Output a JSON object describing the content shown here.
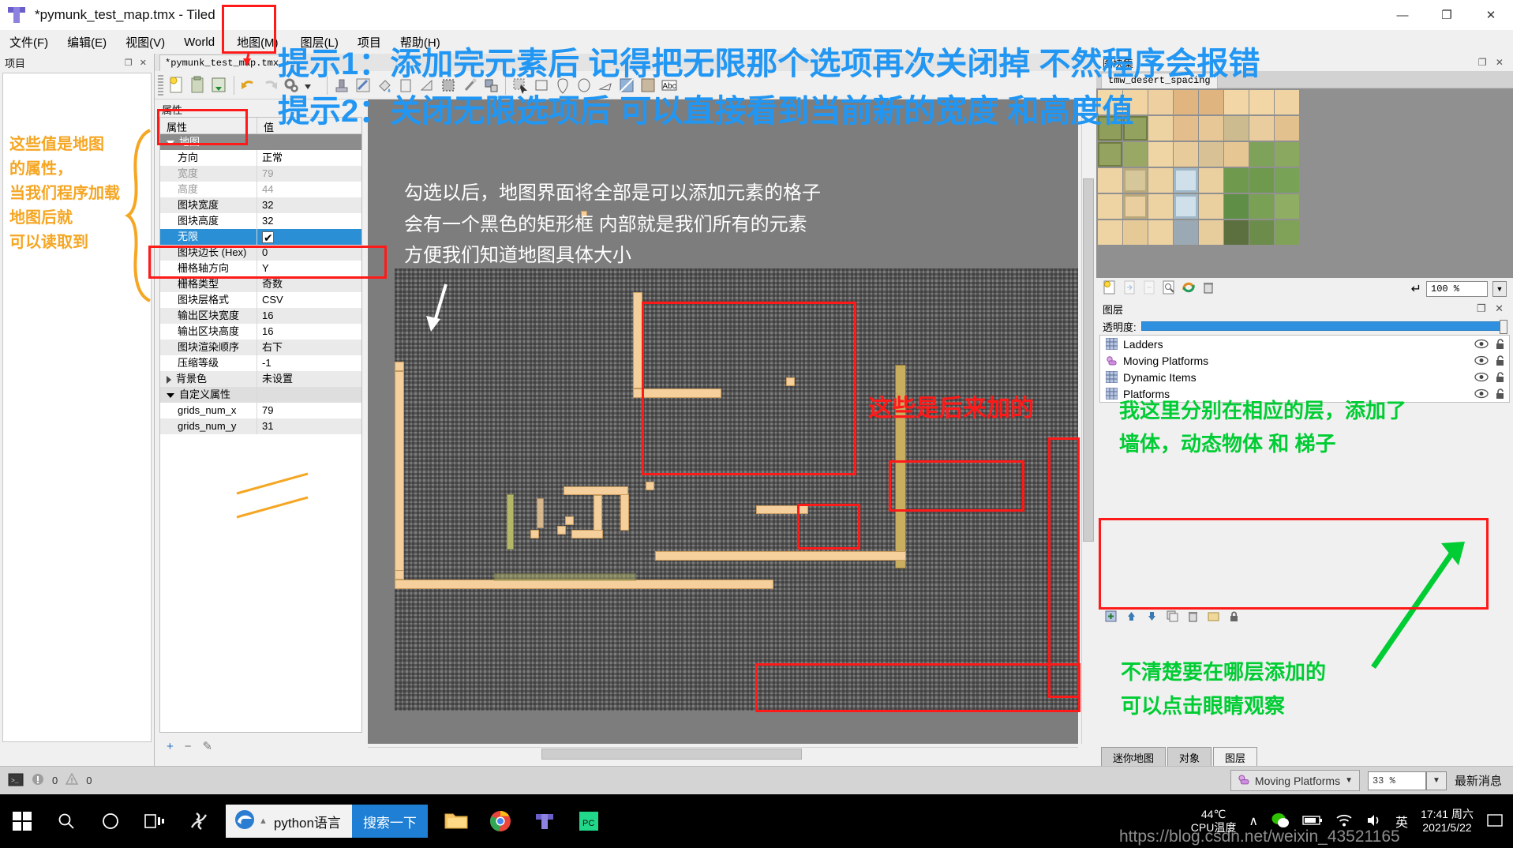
{
  "window": {
    "title": "*pymunk_test_map.tmx - Tiled",
    "logo_icon": "tiled-logo-icon",
    "minimize": "—",
    "maximize": "❐",
    "close": "✕"
  },
  "menubar": {
    "items": [
      {
        "label": "文件(F)"
      },
      {
        "label": "编辑(E)"
      },
      {
        "label": "视图(V)"
      },
      {
        "label": "World"
      },
      {
        "label": "地图(M)"
      },
      {
        "label": "图层(L)"
      },
      {
        "label": "项目"
      },
      {
        "label": "帮助(H)"
      }
    ]
  },
  "project_panel": {
    "title": "项目"
  },
  "document": {
    "tab_label": "*pymunk_test_map.tmx",
    "tab_close": "✕"
  },
  "properties": {
    "dock_title": "属性",
    "header": {
      "name": "属性",
      "value": "值"
    },
    "group_label": "地图",
    "rows": [
      {
        "name": "方向",
        "value": "正常",
        "dim": false
      },
      {
        "name": "宽度",
        "value": "79",
        "dim": true
      },
      {
        "name": "高度",
        "value": "44",
        "dim": true
      },
      {
        "name": "图块宽度",
        "value": "32",
        "dim": false
      },
      {
        "name": "图块高度",
        "value": "32",
        "dim": false
      },
      {
        "name": "无限",
        "value": "checkbox-checked",
        "dim": false,
        "selected": true
      },
      {
        "name": "图块边长 (Hex)",
        "value": "0",
        "dim": false
      },
      {
        "name": "栅格轴方向",
        "value": "Y",
        "dim": false
      },
      {
        "name": "栅格类型",
        "value": "奇数",
        "dim": false
      },
      {
        "name": "图块层格式",
        "value": "CSV",
        "dim": false
      },
      {
        "name": "输出区块宽度",
        "value": "16",
        "dim": false
      },
      {
        "name": "输出区块高度",
        "value": "16",
        "dim": false
      },
      {
        "name": "图块渲染顺序",
        "value": "右下",
        "dim": false
      },
      {
        "name": "压缩等级",
        "value": "-1",
        "dim": false
      },
      {
        "name": "背景色",
        "value": "未设置",
        "dim": false,
        "expandable": true
      }
    ],
    "custom_group_label": "自定义属性",
    "custom_rows": [
      {
        "name": "grids_num_x",
        "value": "79"
      },
      {
        "name": "grids_num_y",
        "value": "31"
      }
    ],
    "footer": {
      "add": "+",
      "remove": "−",
      "edit": "✎"
    }
  },
  "tileset_dock": {
    "title": "图块集",
    "tab_label": "tmw_desert_spacing",
    "dropdown_icon": "chevron-down-icon",
    "float_icon": "float-icon",
    "close_icon": "close-icon",
    "toolbar_icons": [
      "new-tileset-icon",
      "embed-icon",
      "export-icon",
      "inspect-icon",
      "refresh-icon",
      "delete-icon"
    ],
    "wrap_icon": "wrap-icon",
    "zoom_value": "100 %"
  },
  "layers_dock": {
    "title": "图层",
    "opacity_label": "透明度:",
    "opacity_value": 100,
    "layers": [
      {
        "name": "Ladders",
        "icon": "tile-layer-icon",
        "visible": true,
        "locked": false
      },
      {
        "name": "Moving Platforms",
        "icon": "object-layer-icon",
        "visible": true,
        "locked": false
      },
      {
        "name": "Dynamic Items",
        "icon": "tile-layer-icon",
        "visible": true,
        "locked": false
      },
      {
        "name": "Platforms",
        "icon": "tile-layer-icon",
        "visible": true,
        "locked": false
      }
    ],
    "footer_icons": [
      "new-layer-icon",
      "raise-layer-icon",
      "lower-layer-icon",
      "duplicate-layer-icon",
      "delete-layer-icon",
      "group-layer-icon",
      "lock-icon"
    ],
    "tabs": [
      {
        "label": "迷你地图",
        "active": false
      },
      {
        "label": "对象",
        "active": false
      },
      {
        "label": "图层",
        "active": true
      }
    ]
  },
  "statusbar": {
    "terminal_icon": "terminal-icon",
    "error_icon": "error-icon",
    "error_count": "0",
    "warning_icon": "warning-icon",
    "warning_count": "0",
    "current_layer": "Moving Platforms",
    "current_layer_icon": "object-layer-icon",
    "zoom": "33 %",
    "news": "最新消息"
  },
  "taskbar": {
    "start_icon": "windows-start-icon",
    "search_icon": "search-icon",
    "cortana_icon": "cortana-circle-icon",
    "taskview_icon": "task-view-icon",
    "apps": [
      "snake-icon",
      "explorer-icon",
      "chrome-icon",
      "tiled-icon",
      "pycharm-icon"
    ],
    "search_box": {
      "browser_icon": "edge-icon",
      "query": "python语言",
      "button": "搜索一下"
    },
    "tray": {
      "temp": "44℃",
      "temp_label": "CPU温度",
      "chevron": "∧",
      "wechat_icon": "wechat-icon",
      "battery_icon": "battery-icon",
      "wifi_icon": "wifi-icon",
      "volume_icon": "volume-icon",
      "ime": "英",
      "time": "17:41 周六",
      "date": "2021/5/22",
      "notify_icon": "notification-icon"
    }
  },
  "annotations": {
    "blue_tip1": "提示1：添加完元素后 记得把无限那个选项再次关闭掉 不然程序会报错",
    "blue_tip2": "提示2：关闭无限选项后 可以直接看到当前新的宽度 和高度值",
    "orange_note": "这些值是地图\n的属性，\n当我们程序加载\n地图后就\n可以读取到",
    "white_note": "勾选以后，地图界面将全部是可以添加元素的格子\n会有一个黑色的矩形框 内部就是我们所有的元素\n方便我们知道地图具体大小",
    "red_note": "这些是后来加的",
    "green_note1": "我这里分别在相应的层，添加了\n墙体，动态物体 和 梯子",
    "green_note2": "不清楚要在哪层添加的\n可以点击眼睛观察",
    "watermark": "https://blog.csdn.net/weixin_43521165",
    "colors": {
      "blue": "#2196f3",
      "orange": "#f5a623",
      "red": "#ff1a1a",
      "green": "#00cc33",
      "white": "#ffffff"
    }
  }
}
